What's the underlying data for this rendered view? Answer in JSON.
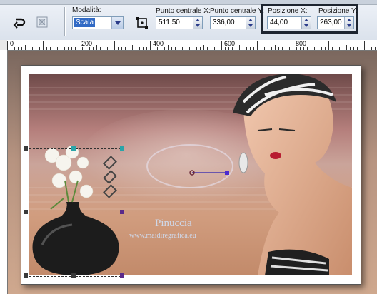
{
  "toolbar": {
    "mode_label": "Modalità:",
    "mode_value": "Scala",
    "center_x_label": "Punto centrale X:",
    "center_x_value": "511,50",
    "center_y_label": "Punto centrale Y:",
    "center_y_value": "336,00",
    "pos_x_label": "Posizione X:",
    "pos_x_value": "44,00",
    "pos_y_label": "Posizione Y:",
    "pos_y_value": "263,00"
  },
  "ruler": {
    "labels": [
      "0",
      "200",
      "400",
      "600",
      "800"
    ]
  },
  "canvas": {
    "watermark_name": "Pinuccia",
    "watermark_url": "www.maidiregrafica.eu"
  },
  "colors": {
    "highlight_box": "#1e2530",
    "handle_teal": "#2aa4a8",
    "handle_purple": "#5a2a8a",
    "center_line": "#2a1fb0"
  }
}
